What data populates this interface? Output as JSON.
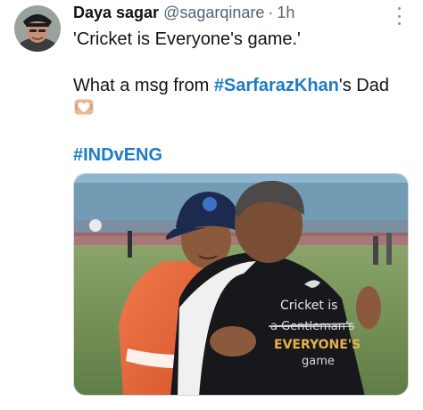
{
  "author": {
    "display_name": "Daya sagar",
    "handle": "@sagarqinare",
    "separator": "·",
    "time": "1h"
  },
  "icons": {
    "more": "more-vertical-icon",
    "emoji": "heart-hands-emoji"
  },
  "tweet": {
    "line1": "'Cricket is Everyone's game.'",
    "line2_prefix": "What a msg from ",
    "line2_hashtag": "#SarfarazKhan",
    "line2_suffix": "'s Dad",
    "hashtag2": "#INDvENG"
  },
  "media": {
    "jacket_line1": "Cricket is",
    "jacket_line2": "a Gentleman's",
    "jacket_line3": "EVERYONE'S",
    "jacket_line4": "game"
  },
  "colors": {
    "hashtag": "#1d7bc8",
    "secondary_text": "#536471"
  }
}
